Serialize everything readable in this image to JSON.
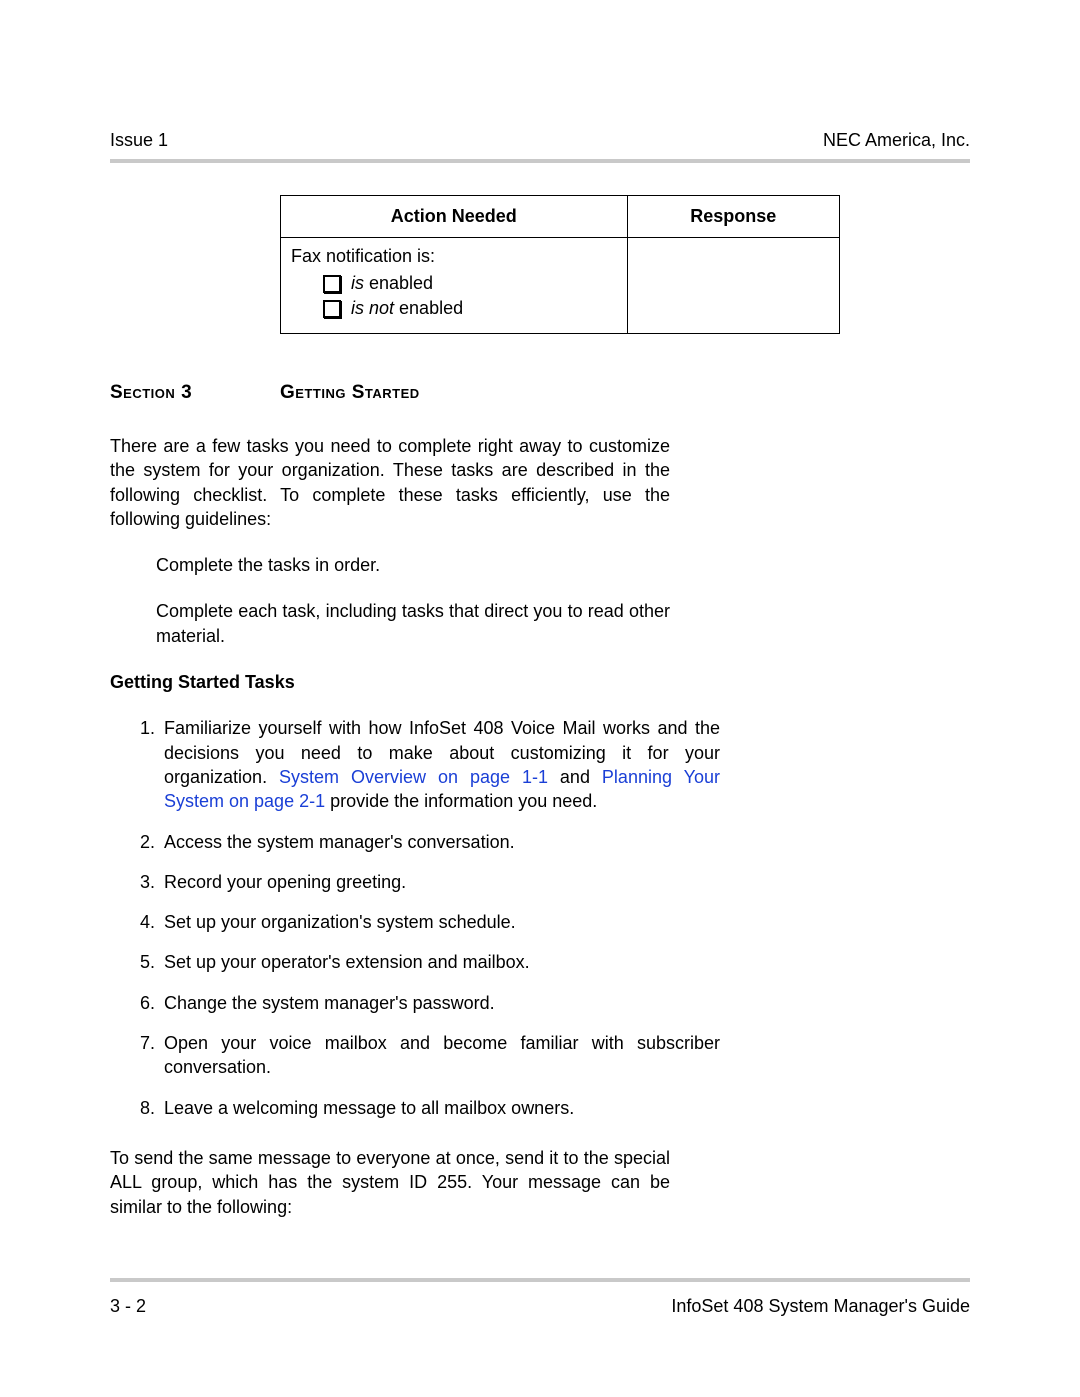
{
  "header": {
    "left": "Issue 1",
    "right": "NEC America, Inc."
  },
  "table": {
    "col_action": "Action Needed",
    "col_response": "Response",
    "row_label": "Fax notification is:",
    "opt1_prefix": "is",
    "opt1_rest": " enabled",
    "opt2_prefix": "is not",
    "opt2_rest": " enabled"
  },
  "section": {
    "label_word": "Section",
    "label_num": " 3",
    "title_word1": "Getting",
    "title_word2": " Started"
  },
  "intro": "There are a few tasks you need to complete right away to customize the system for your organization. These tasks are described in the following checklist. To complete these tasks efficiently, use the following guidelines:",
  "guidelines": {
    "g1": "Complete the tasks in order.",
    "g2": "Complete each task, including tasks that direct you to read other material."
  },
  "tasks_heading": "Getting Started Tasks",
  "tasks": {
    "t1_a": "Familiarize yourself with how InfoSet 408 Voice Mail works and the decisions you need to make about customizing it for your organization. ",
    "t1_link1": "System Overview on page 1-1",
    "t1_mid": " and ",
    "t1_link2": "Planning Your System on page 2-1",
    "t1_b": " provide the information you need.",
    "t2": "Access the system manager's conversation.",
    "t3": "Record your opening greeting.",
    "t4": "Set up your organization's system schedule.",
    "t5": "Set up your operator's extension and mailbox.",
    "t6": "Change the system manager's password.",
    "t7": "Open your voice mailbox and become familiar with subscriber conversation.",
    "t8": "Leave a welcoming message to all mailbox owners."
  },
  "closing": "To send the same message to everyone at once, send it to the special ALL group, which has the system ID 255. Your message can be similar to the following:",
  "footer": {
    "left": "3 - 2",
    "right": "InfoSet 408 System Manager's Guide"
  }
}
